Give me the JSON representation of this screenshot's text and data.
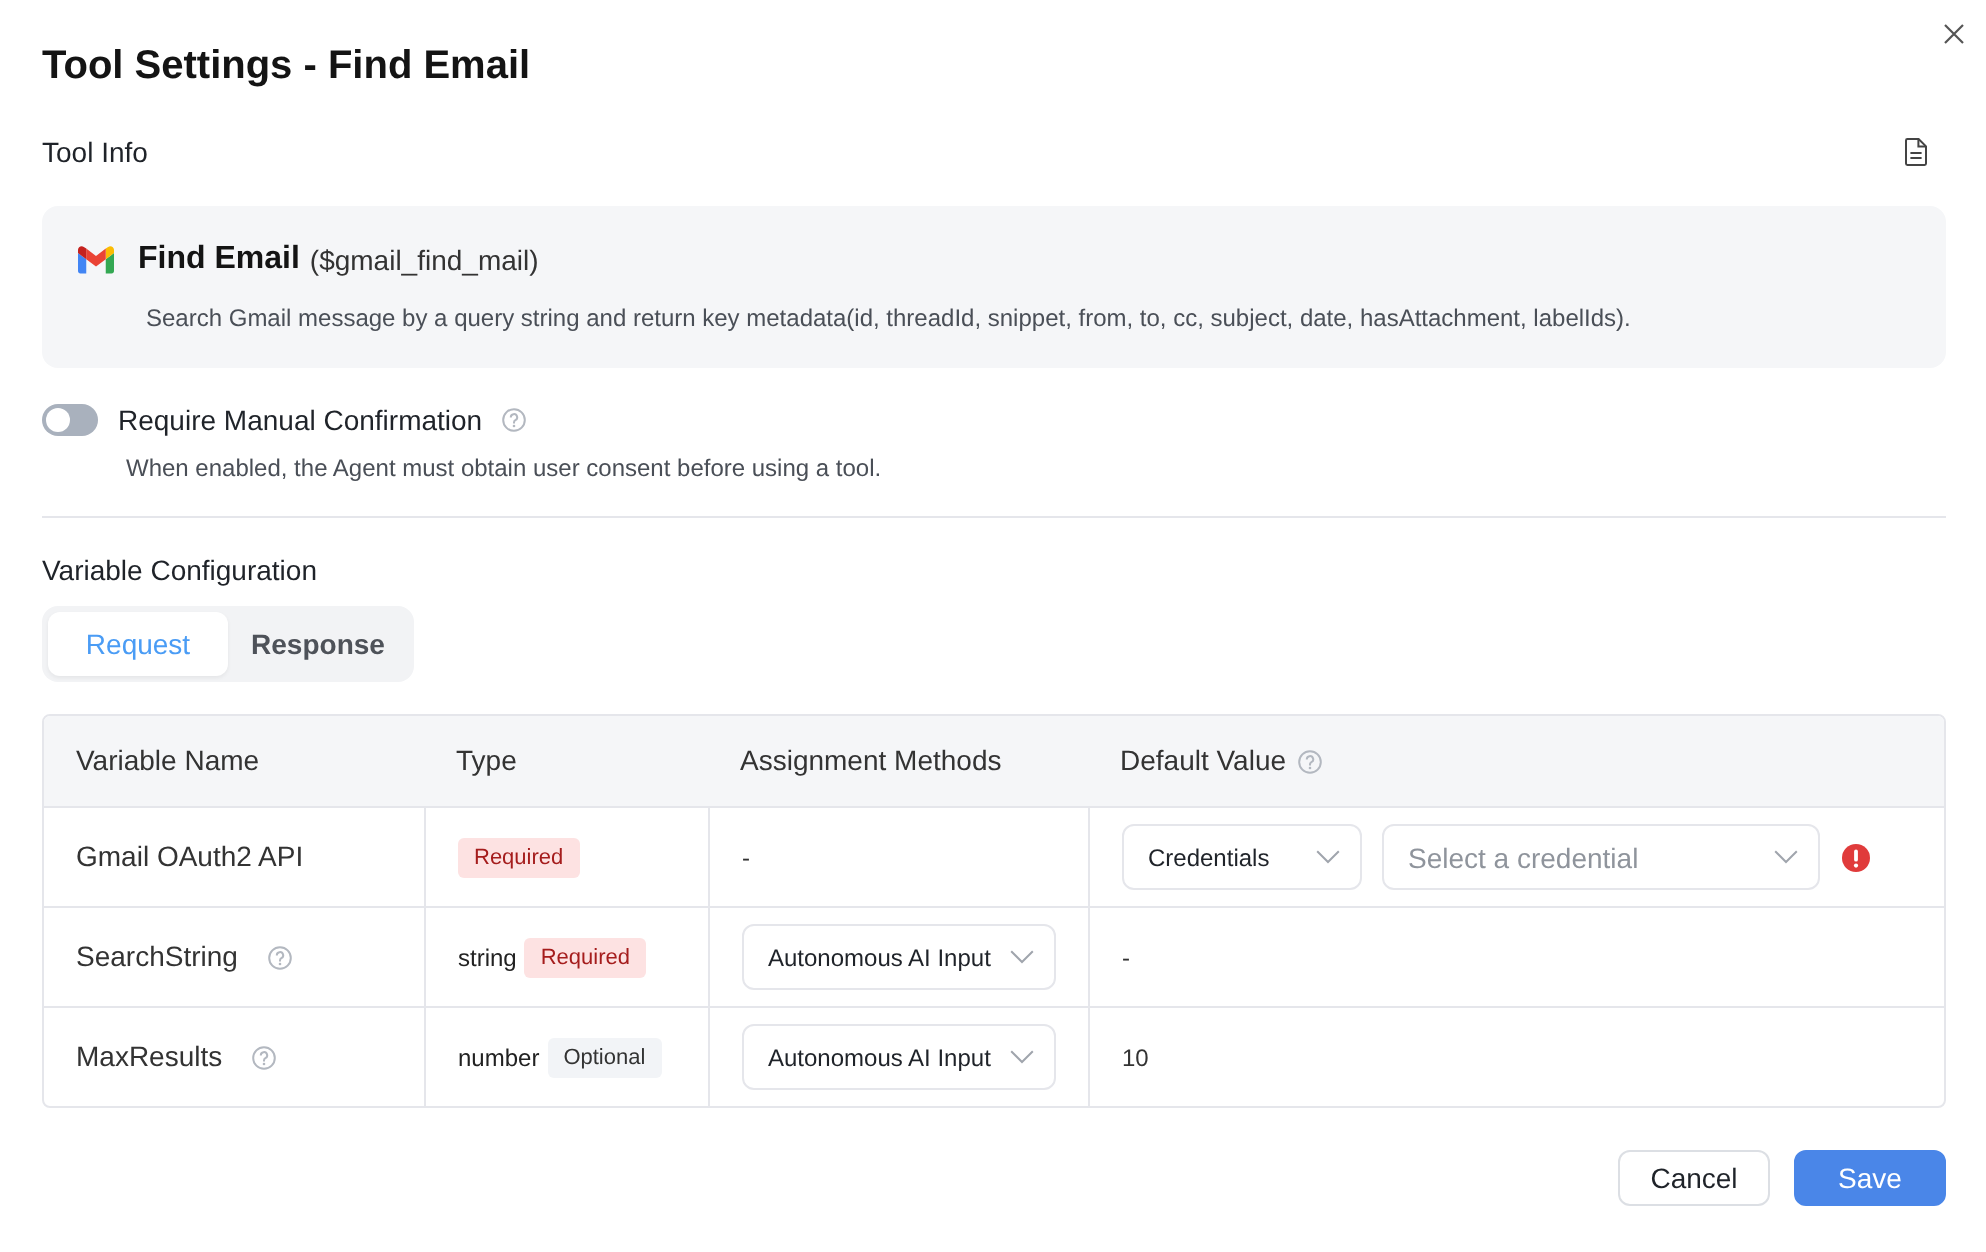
{
  "dialog": {
    "title": "Tool Settings - Find Email"
  },
  "tool_info": {
    "heading": "Tool Info",
    "name": "Find Email",
    "function": "($gmail_find_mail)",
    "description": "Search Gmail message by a query string and return key metadata(id, threadId, snippet, from, to, cc, subject, date, hasAttachment, labelIds)."
  },
  "manual_confirmation": {
    "label": "Require Manual Confirmation",
    "on": false,
    "description": "When enabled, the Agent must obtain user consent before using a tool."
  },
  "variable_configuration": {
    "heading": "Variable Configuration",
    "tabs": [
      {
        "label": "Request",
        "selected": true
      },
      {
        "label": "Response",
        "selected": false
      }
    ],
    "columns": [
      {
        "label": "Variable Name",
        "help": false
      },
      {
        "label": "Type",
        "help": false
      },
      {
        "label": "Assignment Methods",
        "help": false
      },
      {
        "label": "Default Value",
        "help": true
      }
    ],
    "rows": [
      {
        "name": "Gmail OAuth2 API",
        "help": false,
        "tag": {
          "label": "Required",
          "kind": "required"
        },
        "assignment": {
          "kind": "text",
          "text": "-"
        },
        "default": {
          "kind": "credential",
          "source": "Credentials",
          "placeholder": "Select a credential",
          "error": true
        }
      },
      {
        "name": "SearchString",
        "help": true,
        "type": "string",
        "tag": {
          "label": "Required",
          "kind": "required"
        },
        "assignment": {
          "kind": "select",
          "value": "Autonomous AI Input"
        },
        "default": {
          "kind": "text",
          "text": "-"
        }
      },
      {
        "name": "MaxResults",
        "help": true,
        "type": "number",
        "tag": {
          "label": "Optional",
          "kind": "optional"
        },
        "assignment": {
          "kind": "select",
          "value": "Autonomous AI Input"
        },
        "default": {
          "kind": "text",
          "text": "10"
        }
      }
    ]
  },
  "buttons": [
    {
      "label": "Cancel",
      "kind": "secondary"
    },
    {
      "label": "Save",
      "kind": "primary"
    }
  ]
}
